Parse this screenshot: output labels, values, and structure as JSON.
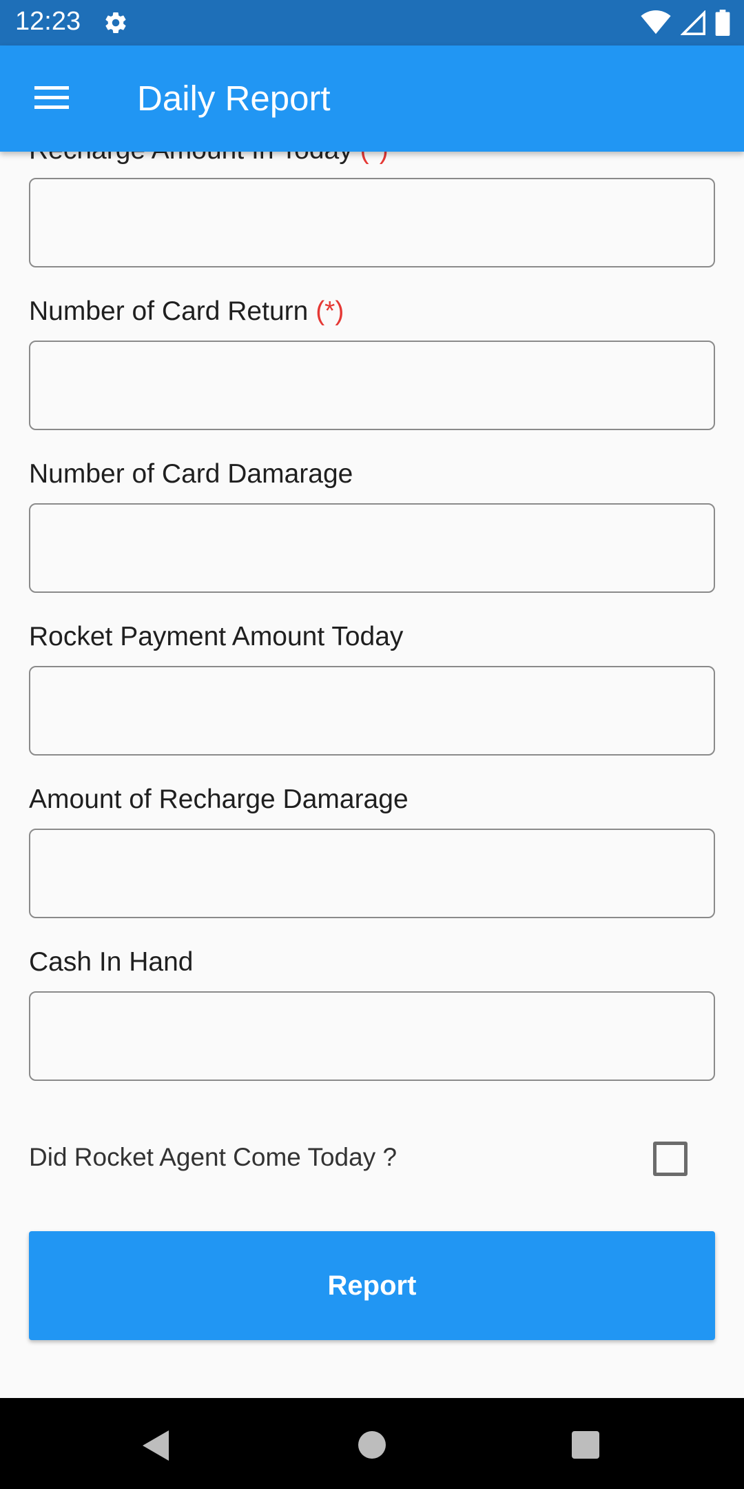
{
  "status_bar": {
    "time": "12:23"
  },
  "app_bar": {
    "title": "Daily Report"
  },
  "form": {
    "partial_field": {
      "label": "Recharge Amount In Today",
      "required_mark": "(*)"
    },
    "fields": [
      {
        "label": "Number of Card Return",
        "required_mark": "(*)",
        "value": ""
      },
      {
        "label": "Number of Card Damarage",
        "value": ""
      },
      {
        "label": "Rocket Payment Amount Today",
        "value": ""
      },
      {
        "label": "Amount of Recharge Damarage",
        "value": ""
      },
      {
        "label": "Cash In Hand",
        "value": ""
      }
    ],
    "checkbox": {
      "label": "Did Rocket Agent Come Today ?",
      "checked": false
    },
    "submit_label": "Report"
  },
  "colors": {
    "status_bar": "#1e6fb8",
    "primary": "#2196f3",
    "required": "#e53935"
  },
  "icons": {
    "status": [
      "gear-icon",
      "wifi-icon",
      "signal-icon",
      "battery-icon"
    ],
    "app_bar": [
      "menu-icon"
    ],
    "nav": [
      "back-icon",
      "home-icon",
      "recent-apps-icon"
    ]
  }
}
